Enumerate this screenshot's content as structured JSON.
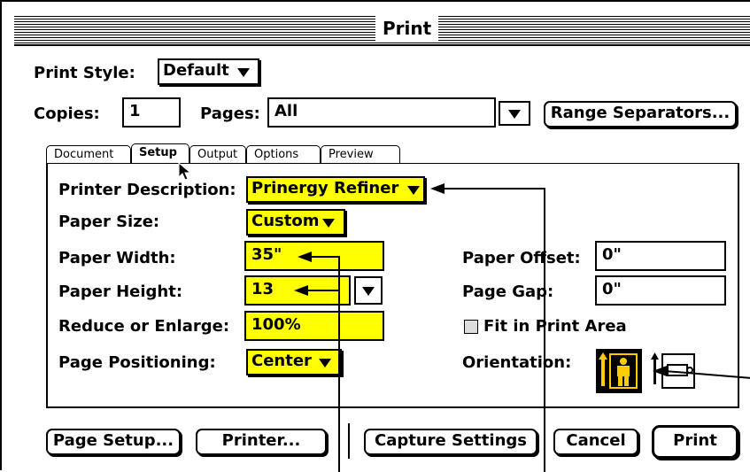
{
  "window": {
    "title": "Print"
  },
  "print_style": {
    "label": "Print Style:",
    "value": "Default"
  },
  "copies": {
    "label": "Copies:",
    "value": "1"
  },
  "pages": {
    "label": "Pages:",
    "value": "All"
  },
  "range_separators_button": "Range Separators...",
  "tabs": [
    {
      "label": "Document"
    },
    {
      "label": "Setup",
      "active": true
    },
    {
      "label": "Output"
    },
    {
      "label": "Options"
    },
    {
      "label": "Preview"
    }
  ],
  "setup": {
    "printer_description": {
      "label": "Printer Description:",
      "value": "Prinergy Refiner"
    },
    "paper_size": {
      "label": "Paper Size:",
      "value": "Custom"
    },
    "paper_width": {
      "label": "Paper Width:",
      "value": "35\""
    },
    "paper_height": {
      "label": "Paper Height:",
      "value": "13"
    },
    "reduce_enlarge": {
      "label": "Reduce or Enlarge:",
      "value": "100%"
    },
    "page_positioning": {
      "label": "Page Positioning:",
      "value": "Center"
    },
    "paper_offset": {
      "label": "Paper Offset:",
      "value": "0\""
    },
    "page_gap": {
      "label": "Page Gap:",
      "value": "0\""
    },
    "fit_in_print_area": {
      "label": "Fit in Print Area",
      "checked": false
    },
    "orientation": {
      "label": "Orientation:",
      "selected": "portrait"
    }
  },
  "buttons": {
    "page_setup": "Page Setup...",
    "printer": "Printer...",
    "capture_settings": "Capture Settings",
    "cancel": "Cancel",
    "print": "Print"
  },
  "colors": {
    "highlight": "#ffff00",
    "selected_icon": "#000000",
    "icon_fill": "#ffcc00"
  }
}
